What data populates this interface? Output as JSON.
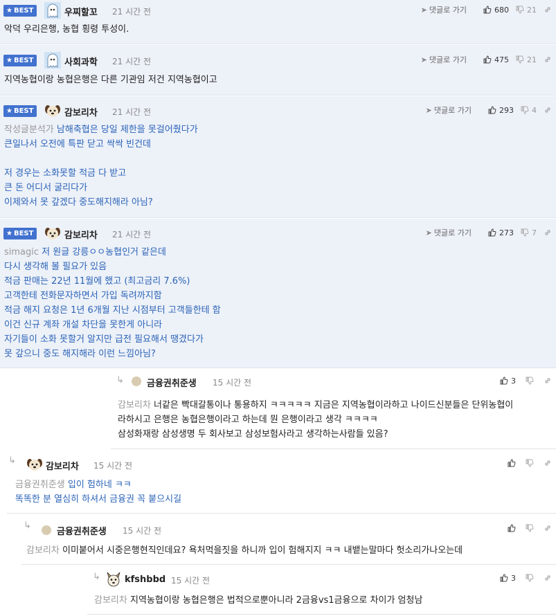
{
  "labels": {
    "best": "BEST",
    "goto_reply": "댓글로 가기"
  },
  "colors": {
    "best_badge": "#4272cf",
    "best_row_bg": "#edf1f8",
    "mention": "#999999",
    "link_text": "#2b64b8"
  },
  "comments": [
    {
      "nick": "우찌할꼬",
      "time": "21 시간 전",
      "up": "680",
      "down": "21",
      "avatar_icon": "ghost-avatar-icon",
      "lines": [
        {
          "text": "악덕 우리은행, 농협 횡령 투성이."
        }
      ]
    },
    {
      "nick": "사회과학",
      "time": "21 시간 전",
      "up": "475",
      "down": "21",
      "avatar_icon": "ghost-avatar-icon",
      "lines": [
        {
          "text": "지역농협이랑 농협은행은 다른 기관임 저건 지역농협이고"
        }
      ]
    },
    {
      "nick": "감보리차",
      "time": "21 시간 전",
      "up": "293",
      "down": "4",
      "avatar_icon": "puppy-avatar-icon",
      "lines": [
        {
          "mention": "작성글분석가",
          "text": "남해축협은 당일 제한을 못걸어줬다가"
        },
        {
          "text": "큰일나서 오전에 특판 닫고 싹싹 빈건데"
        },
        {
          "text": ""
        },
        {
          "text": "저 경우는 소화못할 적금 다 받고"
        },
        {
          "text": "큰 돈 어디서 굴리다가"
        },
        {
          "text": "이제와서 못 갚겠다 중도해지해라 아님?"
        }
      ]
    },
    {
      "nick": "감보리차",
      "time": "21 시간 전",
      "up": "273",
      "down": "7",
      "avatar_icon": "puppy-avatar-icon",
      "lines": [
        {
          "mention": "simagic",
          "text": "저 원글 강릉ㅇㅇ농협인거 같은데"
        },
        {
          "text": "다시 생각해 볼 필요가 있음"
        },
        {
          "text": "적금 판매는 22년 11월에 했고 (최고금리 7.6%)"
        },
        {
          "text": "고객한테 전화문자하면서 가입 독려까지함"
        },
        {
          "text": "적금 해지 요청은 1년 6개월 지난 시점부터 고객들한테 함"
        },
        {
          "text": "이건 신규 계좌 개설 차단을 못한게 아니라"
        },
        {
          "text": "자기들이 소화 못할거 알지만 급전 필요해서 땡겼다가"
        },
        {
          "text": "못 갚으니 중도 해지해라 이런 느낌아님?"
        }
      ]
    }
  ],
  "replies": [
    {
      "nick": "금융권취준생",
      "time": "15 시간 전",
      "up": "3",
      "down": "",
      "lines": [
        {
          "mention": "감보리차",
          "text": "너같은 빡대갈통이나 통용하지 ㅋㅋㅋㅋㅋ 지금은 지역농협이라하고 나이드신분들은 단위농협이"
        },
        {
          "text": "라하시고 은행은 농협은행이라고 하는데 뭔 은행이라고 생각 ㅋㅋㅋㅋ"
        },
        {
          "text": "삼성화재랑 삼성생명 두 회사보고 삼성보험사라고 생각하는사람들 있음?"
        }
      ]
    },
    {
      "nick": "감보리차",
      "time": "15 시간 전",
      "up": "",
      "down": "",
      "lines": [
        {
          "mention": "금융권취준생",
          "text": "입이 험하네 ㅋㅋ"
        },
        {
          "text": "똑똑한 분 열심히 하셔서 금융권 꼭 붙으시길"
        }
      ]
    },
    {
      "nick": "금융권취준생",
      "time": "15 시간 전",
      "up": "",
      "down": "",
      "lines": [
        {
          "mention": "감보리차",
          "text": "이미붙어서 시중은행현직인데요? 욕처먹을짓을 하니까 입이 험해지지 ㅋㅋ 내뱉는말마다 헛소리가나오는데"
        }
      ]
    },
    {
      "nick": "kfshbbd",
      "time": "15 시간 전",
      "up": "3",
      "down": "",
      "lines": [
        {
          "mention": "감보리차",
          "text": "지역농협이랑 농협은행은 법적으로뿐아니라 2금융vs1금융으로 차이가 엄청남"
        }
      ]
    }
  ]
}
